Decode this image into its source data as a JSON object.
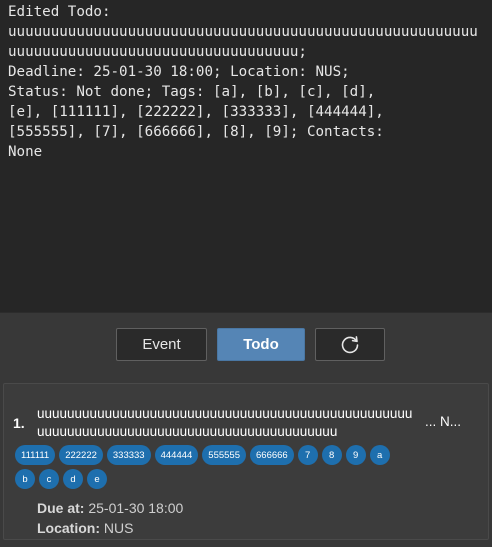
{
  "result_display": {
    "text": "Edited Todo:\nuuuuuuuuuuuuuuuuuuuuuuuuuuuuuuuuuuuuuuuuuuuuuuuuuuuuuuuuuuuuuuuuuuuuuuuuuuuuuuuuuuuuuuuuu;\nDeadline: 25-01-30 18:00; Location: NUS;\nStatus: Not done; Tags: [a], [b], [c], [d],\n[e], [111111], [222222], [333333], [444444],\n[555555], [7], [666666], [8], [9]; Contacts:\nNone"
  },
  "toolbar": {
    "event_label": "Event",
    "todo_label": "Todo",
    "refresh_icon": "refresh-icon",
    "active_color": "#5585b5"
  },
  "list": {
    "items": [
      {
        "index": "1.",
        "title": "uuuuuuuuuuuuuuuuuuuuuuuuuuuuuuuuuuuuuuuuuuuuuuuuuuuuuuuuuuuuuuuuuuuuuuuuuuuuuuuuuuuuuuuuuu",
        "overflow": "... N...",
        "tags_row1": [
          "111111",
          "222222",
          "333333",
          "444444",
          "555555",
          "666666",
          "7",
          "8",
          "9",
          "a"
        ],
        "tags_row2": [
          "b",
          "c",
          "d",
          "e"
        ],
        "due_label": "Due at:",
        "due_value": "25-01-30 18:00",
        "location_label": "Location:",
        "location_value": "NUS"
      }
    ],
    "tag_color": "#1e6fae"
  }
}
